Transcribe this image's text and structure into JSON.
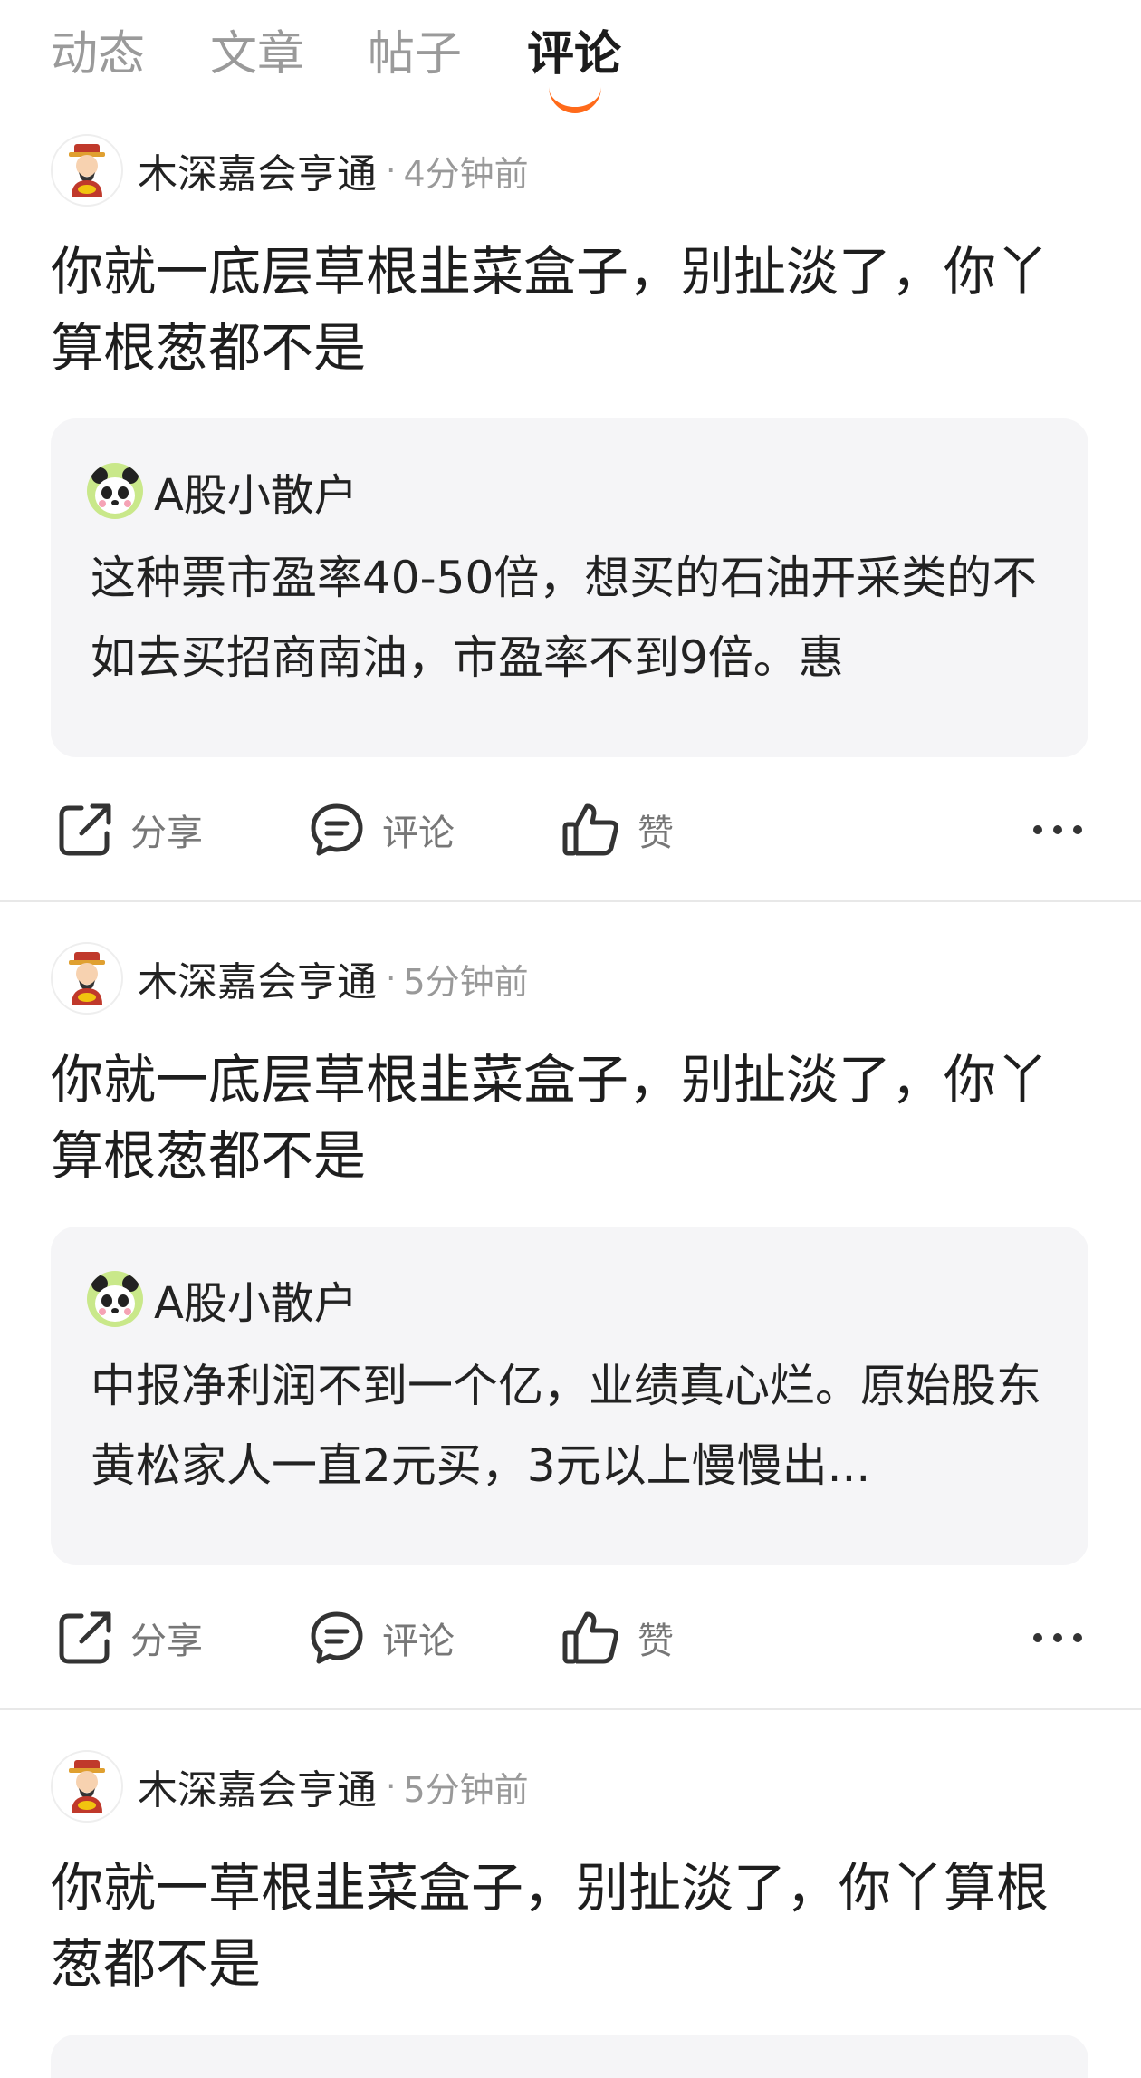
{
  "tabs": [
    {
      "label": "动态",
      "active": false
    },
    {
      "label": "文章",
      "active": false
    },
    {
      "label": "帖子",
      "active": false
    },
    {
      "label": "评论",
      "active": true
    }
  ],
  "accent_color": "#ff6a1a",
  "posts": [
    {
      "author": "木深嘉会亨通",
      "separator": "·",
      "time": "4分钟前",
      "text": "你就一底层草根韭菜盒子，别扯淡了，你丫算根葱都不是",
      "quote": {
        "author": "A股小散户",
        "text": "这种票市盈率40-50倍，想买的石油开采类的不如去买招商南油，市盈率不到9倍。惠"
      },
      "actions": {
        "share": "分享",
        "comment": "评论",
        "like": "赞"
      }
    },
    {
      "author": "木深嘉会亨通",
      "separator": "·",
      "time": "5分钟前",
      "text": "你就一底层草根韭菜盒子，别扯淡了，你丫算根葱都不是",
      "quote": {
        "author": "A股小散户",
        "text": "中报净利润不到一个亿，业绩真心烂。原始股东黄松家人一直2元买，3元以上慢慢出..."
      },
      "actions": {
        "share": "分享",
        "comment": "评论",
        "like": "赞"
      }
    },
    {
      "author": "木深嘉会亨通",
      "separator": "·",
      "time": "5分钟前",
      "text": "你就一草根韭菜盒子，别扯淡了，你丫算根葱都不是"
    }
  ]
}
